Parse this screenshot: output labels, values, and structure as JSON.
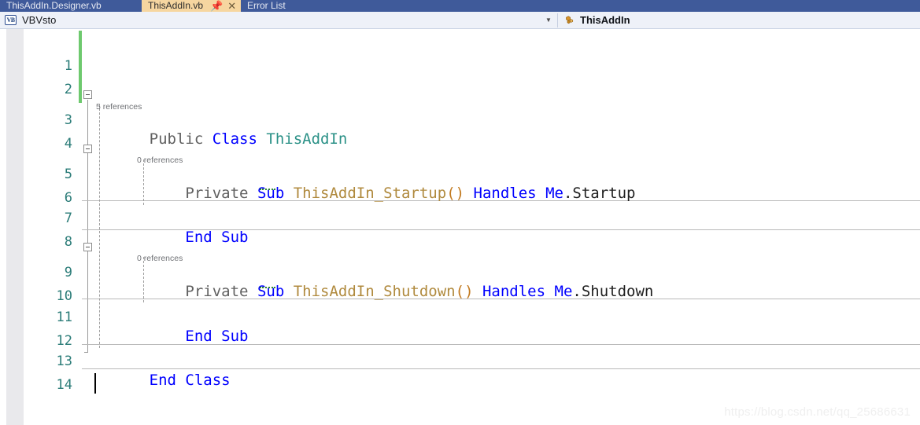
{
  "window": {
    "tabs": [
      {
        "label": "ThisAddIn.Designer.vb",
        "active": false
      },
      {
        "label": "ThisAddIn.vb",
        "active": true,
        "pin_icon": "pin-icon",
        "close_icon": "close-icon"
      },
      {
        "label": "Error List",
        "active": false
      }
    ]
  },
  "navbar": {
    "project_icon": "VB",
    "project_label": "VBVsto",
    "caret_icon": "chevron-down-icon",
    "class_icon": "class-icon",
    "class_label": "ThisAddIn"
  },
  "editor": {
    "line_numbers": [
      "1",
      "2",
      "3",
      "4",
      "5",
      "6",
      "7",
      "8",
      "9",
      "10",
      "11",
      "12",
      "13",
      "14"
    ],
    "codelens": [
      {
        "line": 3,
        "text": "5 references"
      },
      {
        "line": 5,
        "text": "0 references"
      },
      {
        "line": 9,
        "text": "0 references"
      }
    ],
    "lines": [
      {
        "n": 1,
        "tokens": []
      },
      {
        "n": 2,
        "tokens": []
      },
      {
        "n": 3,
        "tokens": [
          {
            "t": "Public",
            "c": "mod"
          },
          {
            "t": " ",
            "c": "plain"
          },
          {
            "t": "Class",
            "c": "kw"
          },
          {
            "t": " ",
            "c": "plain"
          },
          {
            "t": "ThisAddIn",
            "c": "type"
          }
        ]
      },
      {
        "n": 4,
        "tokens": []
      },
      {
        "n": 5,
        "tokens": [
          {
            "t": "    ",
            "c": "plain"
          },
          {
            "t": "Private",
            "c": "mod"
          },
          {
            "t": " ",
            "c": "plain"
          },
          {
            "t": "Sub",
            "c": "kw"
          },
          {
            "t": " ",
            "c": "plain"
          },
          {
            "t": "ThisAddIn_Startup",
            "c": "id"
          },
          {
            "t": "()",
            "c": "paren"
          },
          {
            "t": " ",
            "c": "plain"
          },
          {
            "t": "Handles",
            "c": "kw"
          },
          {
            "t": " ",
            "c": "plain"
          },
          {
            "t": "Me",
            "c": "kw"
          },
          {
            "t": ".",
            "c": "plain"
          },
          {
            "t": "Startup",
            "c": "plain"
          }
        ]
      },
      {
        "n": 6,
        "tokens": []
      },
      {
        "n": 7,
        "tokens": [
          {
            "t": "    ",
            "c": "plain"
          },
          {
            "t": "End Sub",
            "c": "kw"
          }
        ]
      },
      {
        "n": 8,
        "tokens": []
      },
      {
        "n": 9,
        "tokens": [
          {
            "t": "    ",
            "c": "plain"
          },
          {
            "t": "Private",
            "c": "mod"
          },
          {
            "t": " ",
            "c": "plain"
          },
          {
            "t": "Sub",
            "c": "kw"
          },
          {
            "t": " ",
            "c": "plain"
          },
          {
            "t": "ThisAddIn_Shutdown",
            "c": "id"
          },
          {
            "t": "()",
            "c": "paren"
          },
          {
            "t": " ",
            "c": "plain"
          },
          {
            "t": "Handles",
            "c": "kw"
          },
          {
            "t": " ",
            "c": "plain"
          },
          {
            "t": "Me",
            "c": "kw"
          },
          {
            "t": ".",
            "c": "plain"
          },
          {
            "t": "Shutdown",
            "c": "plain"
          }
        ]
      },
      {
        "n": 10,
        "tokens": []
      },
      {
        "n": 11,
        "tokens": [
          {
            "t": "    ",
            "c": "plain"
          },
          {
            "t": "End Sub",
            "c": "kw"
          }
        ]
      },
      {
        "n": 12,
        "tokens": []
      },
      {
        "n": 13,
        "tokens": [
          {
            "t": "End Class",
            "c": "kw"
          }
        ]
      },
      {
        "n": 14,
        "tokens": []
      }
    ],
    "cursor_line": 14
  },
  "watermark": "https://blog.csdn.net/qq_25686631",
  "colors": {
    "tab_active_bg": "#f6d6a0",
    "tab_strip_bg": "#3f5a9a",
    "navbar_bg": "#eef1f8",
    "keyword": "#0000ff",
    "type": "#2b9187",
    "identifier": "#b08a3e",
    "paren": "#c27a20",
    "modifier": "#606060",
    "linenum": "#2b7c78",
    "changebar": "#6ec96e",
    "codelens": "#6f7175"
  }
}
